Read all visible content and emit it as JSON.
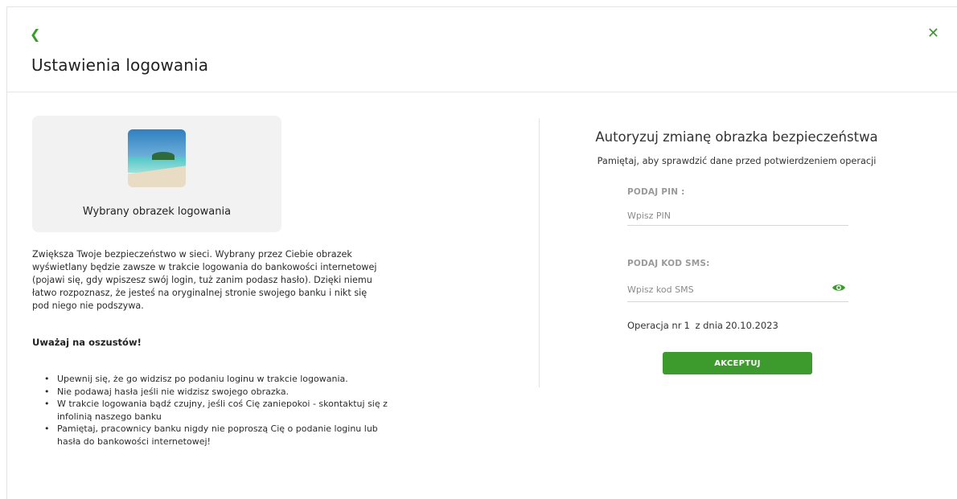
{
  "header": {
    "back_icon": "chevron-left-icon",
    "close_icon": "close-icon",
    "title": "Ustawienia logowania"
  },
  "left": {
    "image_caption": "Wybrany obrazek logowania",
    "description": "Zwiększa Twoje bezpieczeństwo w sieci. Wybrany przez Ciebie obrazek wyświetlany będzie zawsze w trakcie logowania do bankowości internetowej (pojawi się, gdy wpiszesz swój login, tuż zanim podasz hasło). Dzięki niemu łatwo rozpoznasz, że jesteś na oryginalnej stronie swojego banku i nikt się pod niego nie podszywa.",
    "warning_title": "Uważaj na oszustów!",
    "tips": [
      "Upewnij się, że go widzisz po podaniu loginu w trakcie logowania.",
      "Nie podawaj hasła jeśli nie widzisz swojego obrazka.",
      "W trakcie logowania bądź czujny, jeśli coś Cię zaniepokoi - skontaktuj się z infolinią naszego banku",
      "Pamiętaj, pracownicy banku nigdy nie poproszą Cię o podanie loginu lub hasła do bankowości internetowej!"
    ]
  },
  "auth": {
    "title": "Autoryzuj zmianę obrazka bezpieczeństwa",
    "subtitle": "Pamiętaj, aby sprawdzić dane przed potwierdzeniem operacji",
    "pin_label": "PODAJ PIN :",
    "pin_placeholder": "Wpisz PIN",
    "pin_value": "",
    "sms_label": "PODAJ KOD SMS:",
    "sms_placeholder": "Wpisz kod SMS",
    "sms_value": "",
    "sms_eye_icon": "eye-icon",
    "operation_prefix": "Operacja nr",
    "operation_number": "1",
    "operation_date_prefix": "z dnia",
    "operation_date": "20.10.2023",
    "accept_label": "AKCEPTUJ"
  },
  "colors": {
    "accent": "#3d9b2e",
    "card_bg": "#f2f2f2",
    "label_gray": "#9a9a9a"
  }
}
